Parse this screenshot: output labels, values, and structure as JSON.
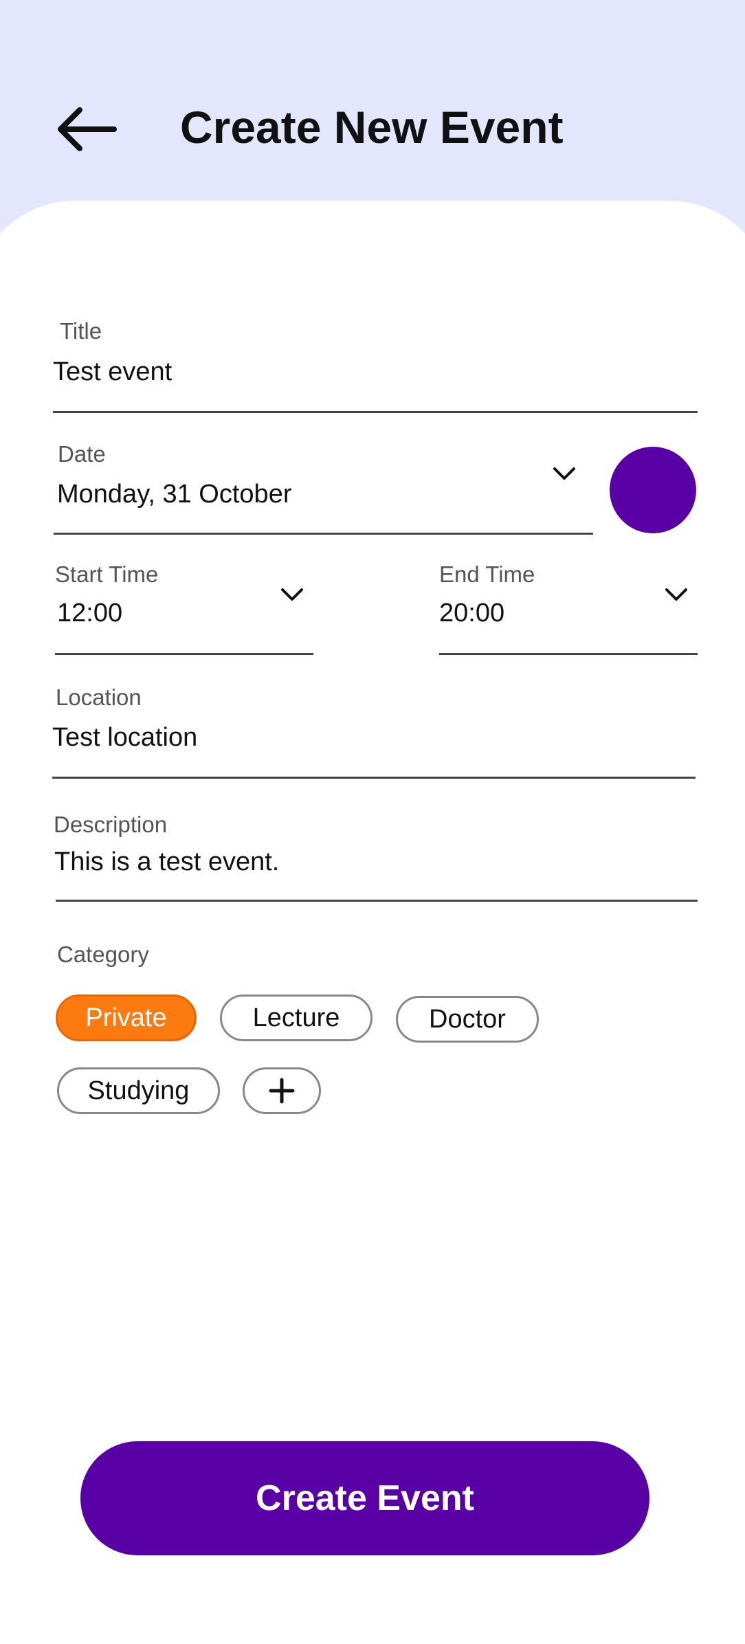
{
  "header": {
    "title": "Create New Event",
    "back_icon": "arrow-left-icon"
  },
  "form": {
    "title": {
      "label": "Title",
      "value": "Test event"
    },
    "date": {
      "label": "Date",
      "value": "Monday, 31 October",
      "color": "#5800a6"
    },
    "start_time": {
      "label": "Start Time",
      "value": "12:00"
    },
    "end_time": {
      "label": "End Time",
      "value": "20:00"
    },
    "location": {
      "label": "Location",
      "value": "Test location"
    },
    "description": {
      "label": "Description",
      "value": "This is a test event."
    }
  },
  "category": {
    "label": "Category",
    "chips": [
      {
        "label": "Private",
        "selected": true
      },
      {
        "label": "Lecture",
        "selected": false
      },
      {
        "label": "Doctor",
        "selected": false
      },
      {
        "label": "Studying",
        "selected": false
      }
    ],
    "add_icon": "plus-icon"
  },
  "actions": {
    "create_label": "Create Event"
  },
  "colors": {
    "accent": "#5800a6",
    "selected_chip": "#fd7a10",
    "header_bg": "#e3e6fc"
  }
}
